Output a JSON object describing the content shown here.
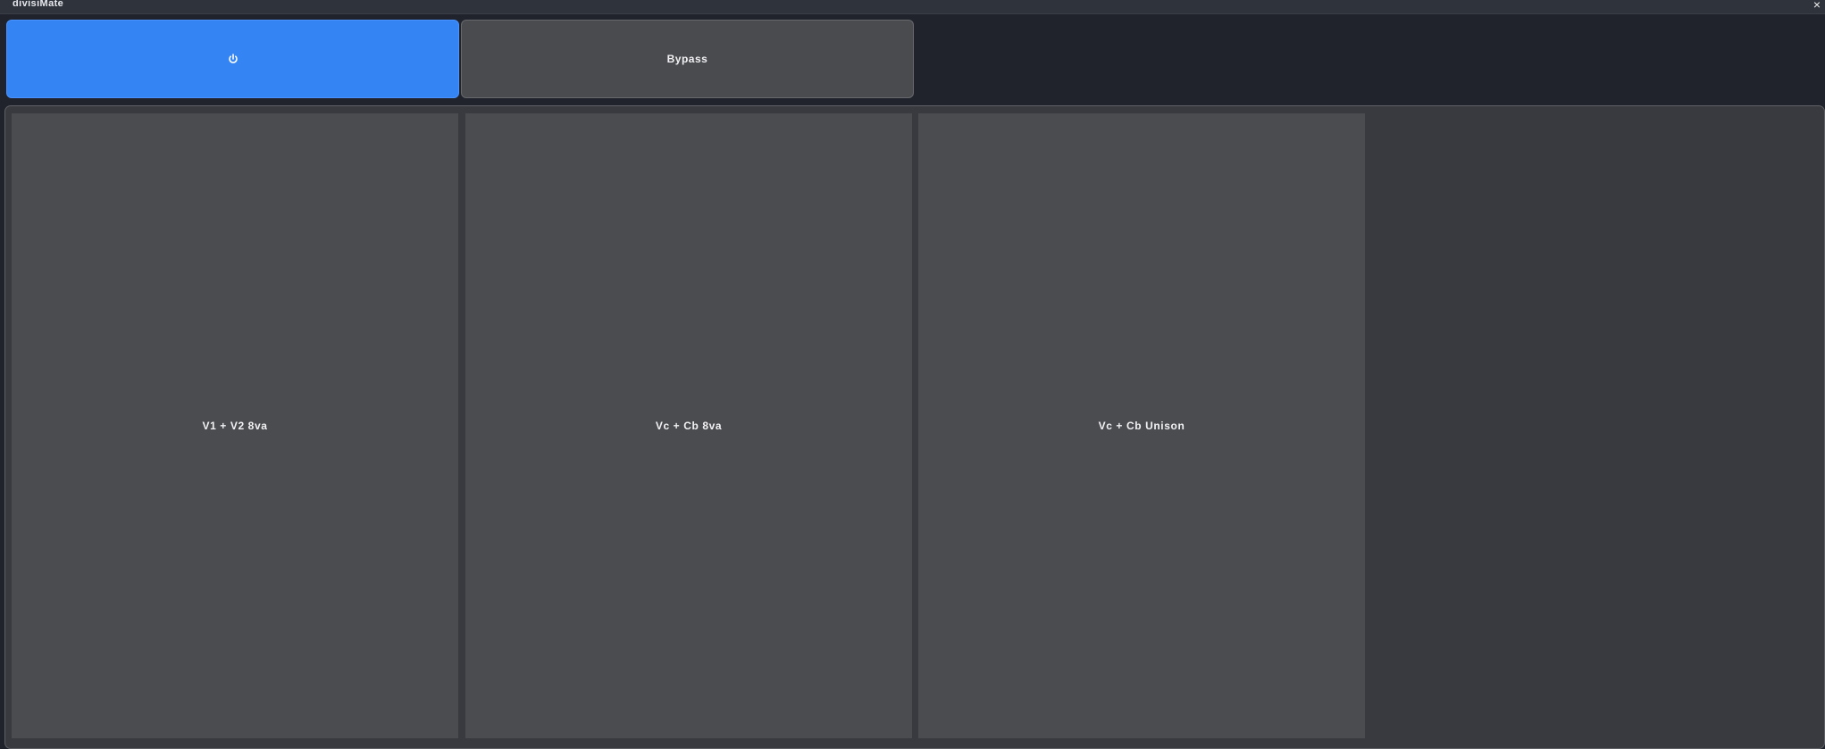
{
  "window": {
    "title": "divisiMate",
    "close_label": "×"
  },
  "toolbar": {
    "power_icon": "power-icon",
    "bypass_label": "Bypass"
  },
  "presets": [
    {
      "label": "V1 + V2 8va"
    },
    {
      "label": "Vc + Cb 8va"
    },
    {
      "label": "Vc + Cb Unison"
    }
  ],
  "colors": {
    "accent": "#3584f3",
    "button": "#4a4b4f",
    "panel": "#393a3f",
    "background": "#20232b"
  }
}
